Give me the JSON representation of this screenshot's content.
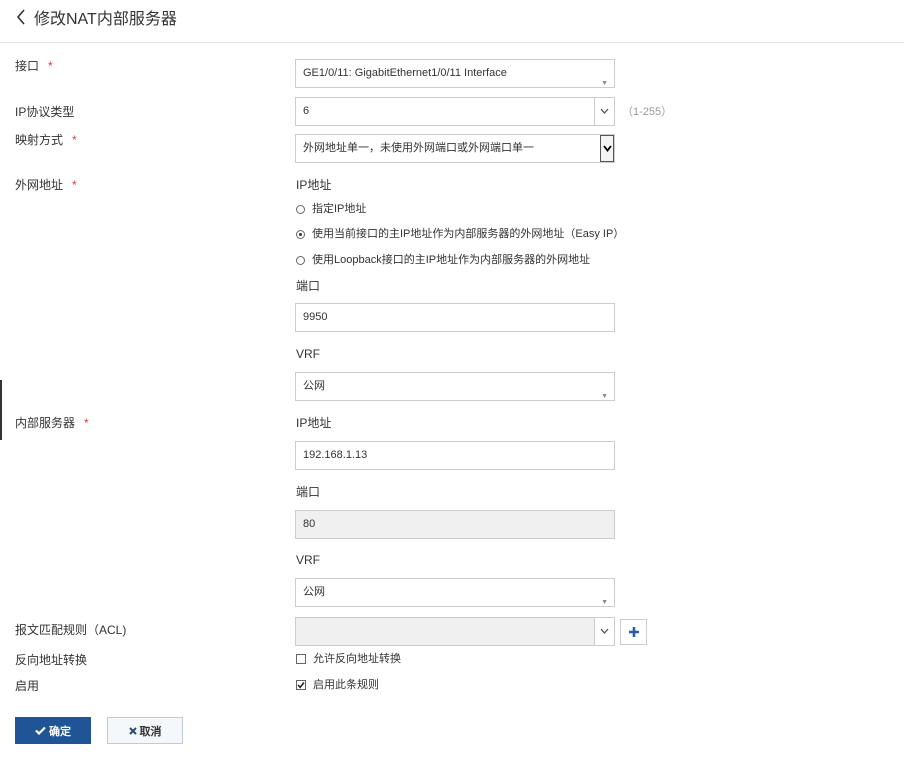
{
  "header": {
    "back_icon": "chevron-left-icon",
    "title": "修改NAT内部服务器"
  },
  "required_mark": "*",
  "form": {
    "interface": {
      "label": "接口",
      "value": "GE1/0/11: GigabitEthernet1/0/11 Interface"
    },
    "ip_protocol": {
      "label": "IP协议类型",
      "value": "6",
      "hint": "（1-255）"
    },
    "mapping": {
      "label": "映射方式",
      "value": "外网地址单一，未使用外网端口或外网端口单一"
    },
    "external": {
      "label": "外网地址",
      "ip_label": "IP地址",
      "options": [
        {
          "label": "指定IP地址",
          "selected": false
        },
        {
          "label": "使用当前接口的主IP地址作为内部服务器的外网地址（Easy IP）",
          "selected": true
        },
        {
          "label": "使用Loopback接口的主IP地址作为内部服务器的外网地址",
          "selected": false
        }
      ],
      "port_label": "端口",
      "port_value": "9950",
      "vrf_label": "VRF",
      "vrf_value": "公网"
    },
    "internal": {
      "label": "内部服务器",
      "ip_label": "IP地址",
      "ip_value": "192.168.1.13",
      "port_label": "端口",
      "port_value": "80",
      "vrf_label": "VRF",
      "vrf_value": "公网"
    },
    "acl": {
      "label": "报文匹配规则（ACL)",
      "value": "",
      "add_icon": "plus-icon"
    },
    "reverse": {
      "label": "反向地址转换",
      "checkbox_label": "允许反向地址转换",
      "checked": false
    },
    "enable": {
      "label": "启用",
      "checkbox_label": "启用此条规则",
      "checked": true
    }
  },
  "buttons": {
    "ok": "确定",
    "cancel": "取消"
  },
  "colors": {
    "primary": "#1f5496",
    "required": "#e4393c",
    "accent_icon": "#2a5fa3"
  }
}
